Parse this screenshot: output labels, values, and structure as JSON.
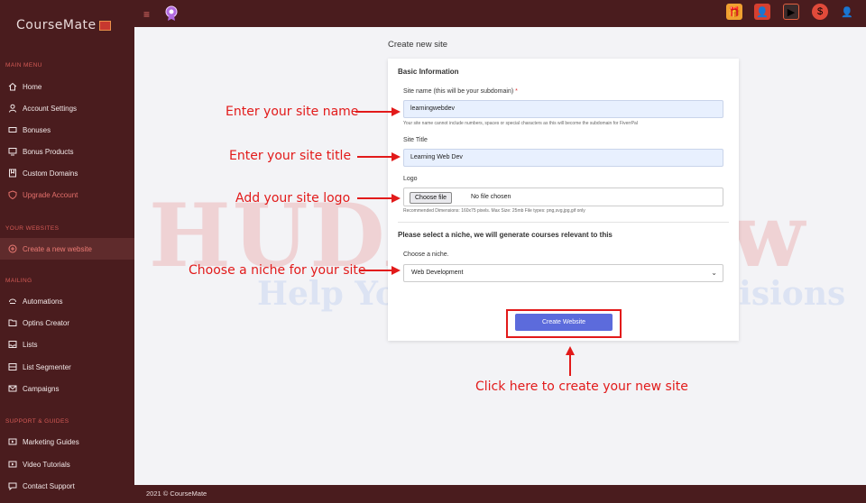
{
  "app": {
    "brand": "CourseMate"
  },
  "sidebar": {
    "sections": {
      "main": "MAIN MENU",
      "websites": "YOUR WEBSITES",
      "mailing": "MAILING",
      "support": "SUPPORT & GUIDES"
    },
    "items": [
      {
        "label": "Home",
        "icon": "home-icon"
      },
      {
        "label": "Account Settings",
        "icon": "user-icon"
      },
      {
        "label": "Bonuses",
        "icon": "ticket-icon"
      },
      {
        "label": "Bonus Products",
        "icon": "monitor-icon"
      },
      {
        "label": "Custom Domains",
        "icon": "bookmark-icon"
      },
      {
        "label": "Upgrade Account",
        "icon": "shield-icon"
      },
      {
        "label": "Create a new website",
        "icon": "plus-circle-icon"
      },
      {
        "label": "Automations",
        "icon": "automation-icon"
      },
      {
        "label": "Optins Creator",
        "icon": "folder-icon"
      },
      {
        "label": "Lists",
        "icon": "inbox-icon"
      },
      {
        "label": "List Segmenter",
        "icon": "segment-icon"
      },
      {
        "label": "Campaigns",
        "icon": "mail-icon"
      },
      {
        "label": "Marketing Guides",
        "icon": "video-icon"
      },
      {
        "label": "Video Tutorials",
        "icon": "video-icon"
      },
      {
        "label": "Contact Support",
        "icon": "chat-icon"
      }
    ]
  },
  "main": {
    "page_title": "Create new site",
    "card_title": "Basic Information",
    "site_name_label": "Site name (this will be your subdomain)",
    "required_mark": "*",
    "site_name_value": "learningwebdev",
    "site_name_hint": "Your site name cannot include numbers, spaces or special characters as this will become the subdomain for FiverrPal",
    "site_title_label": "Site Title",
    "site_title_value": "Learning Web Dev",
    "logo_label": "Logo",
    "choose_file_label": "Choose file",
    "no_file_text": "No file chosen",
    "logo_hint": "Recommended Dimensions: 160x75 pixels. Max Size: 25mb File types: png,svg,jpg,gif only",
    "niche_heading": "Please select a niche, we will generate courses relevant to this",
    "niche_label": "Choose a niche.",
    "niche_value": "Web Development",
    "create_button": "Create Website"
  },
  "annotations": {
    "site_name": "Enter your site name",
    "site_title": "Enter your site title",
    "site_logo": "Add your site logo",
    "niche": "Choose a niche for your site",
    "create": "Click here to create your new site"
  },
  "watermark": {
    "line1": "HUDAReview",
    "line2": "Help You Make Better Decisions"
  },
  "footer": {
    "text": "2021 © CourseMate"
  },
  "colors": {
    "sidebar_bg": "#4a1c1e",
    "accent": "#e4706b",
    "button": "#5c6bdc",
    "annotation": "#e21a1a"
  }
}
